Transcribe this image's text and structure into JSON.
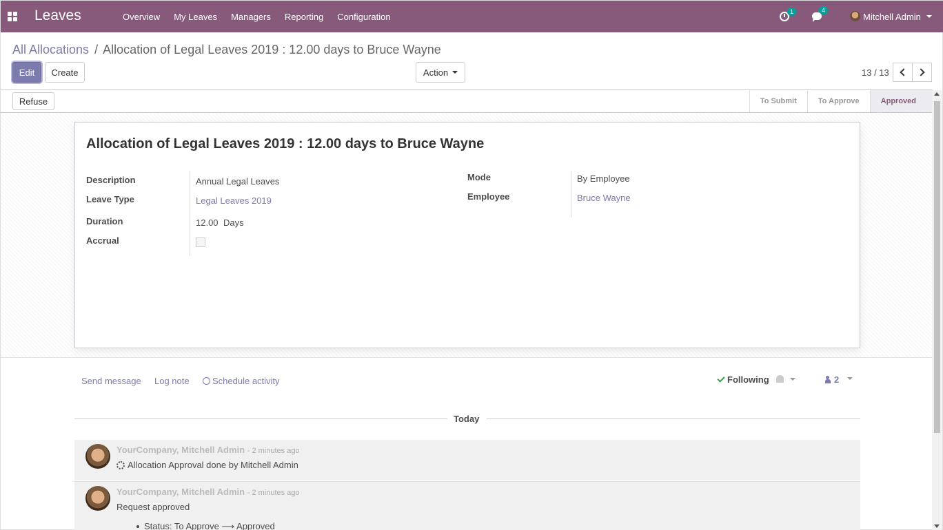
{
  "navbar": {
    "app_name": "Leaves",
    "menu": [
      "Overview",
      "My Leaves",
      "Managers",
      "Reporting",
      "Configuration"
    ],
    "activity_count": "1",
    "message_count": "4",
    "user_name": "Mitchell Admin",
    "color": "#875a7b"
  },
  "breadcrumb": {
    "parent": "All Allocations",
    "separator": "/",
    "current": "Allocation of Legal Leaves 2019 : 12.00 days to Bruce Wayne"
  },
  "buttons": {
    "edit": "Edit",
    "create": "Create",
    "action": "Action",
    "refuse": "Refuse"
  },
  "pager": {
    "value": "13 / 13"
  },
  "stages": [
    {
      "label": "To Submit",
      "active": false
    },
    {
      "label": "To Approve",
      "active": false
    },
    {
      "label": "Approved",
      "active": true
    }
  ],
  "record": {
    "title": "Allocation of Legal Leaves 2019 : 12.00 days to Bruce Wayne",
    "fields": {
      "description": {
        "label": "Description",
        "value": "Annual Legal Leaves"
      },
      "leave_type": {
        "label": "Leave Type",
        "value": "Legal Leaves 2019"
      },
      "duration": {
        "label": "Duration",
        "value": "12.00",
        "unit": "Days"
      },
      "accrual": {
        "label": "Accrual",
        "checked": false
      },
      "mode": {
        "label": "Mode",
        "value": "By Employee"
      },
      "employee": {
        "label": "Employee",
        "value": "Bruce Wayne"
      }
    }
  },
  "chatter": {
    "send_message": "Send message",
    "log_note": "Log note",
    "schedule_activity": "Schedule activity",
    "following": "Following",
    "followers_count": "2",
    "date_separator": "Today",
    "messages": [
      {
        "author": "YourCompany, Mitchell Admin",
        "date": "- 2 minutes ago",
        "body": "Allocation Approval done by Mitchell Admin"
      },
      {
        "author": "YourCompany, Mitchell Admin",
        "date": "- 2 minutes ago",
        "body": "Request approved",
        "tracking": "Status: To Approve ⟶ Approved"
      }
    ]
  }
}
